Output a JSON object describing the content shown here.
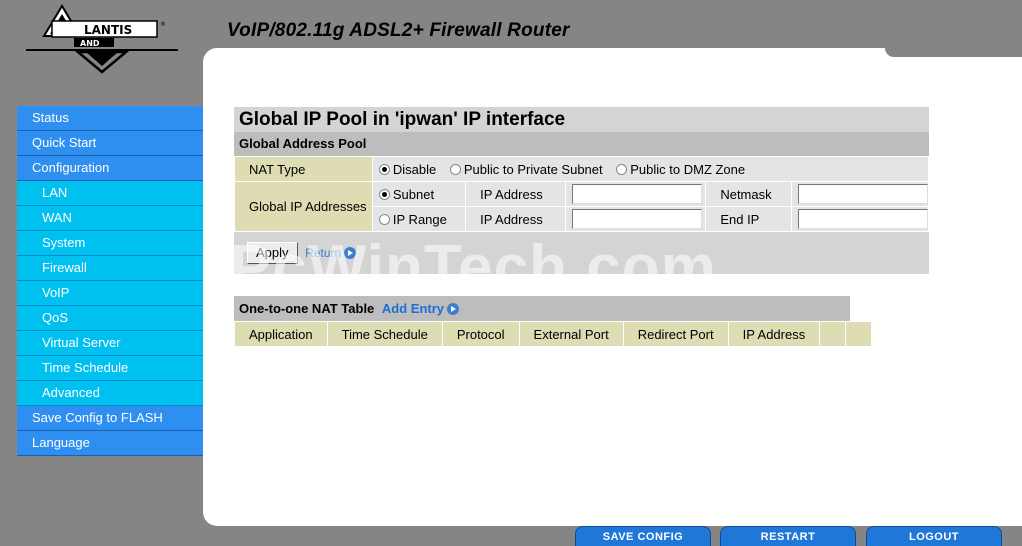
{
  "header": {
    "brand": "ATLANTIS LAND",
    "product_title": "VoIP/802.11g ADSL2+ Firewall Router"
  },
  "sidebar": {
    "items": [
      {
        "label": "Status",
        "level": "main"
      },
      {
        "label": "Quick Start",
        "level": "main"
      },
      {
        "label": "Configuration",
        "level": "main"
      },
      {
        "label": "LAN",
        "level": "sub"
      },
      {
        "label": "WAN",
        "level": "sub"
      },
      {
        "label": "System",
        "level": "sub"
      },
      {
        "label": "Firewall",
        "level": "sub"
      },
      {
        "label": "VoIP",
        "level": "sub"
      },
      {
        "label": "QoS",
        "level": "sub"
      },
      {
        "label": "Virtual Server",
        "level": "sub"
      },
      {
        "label": "Time Schedule",
        "level": "sub"
      },
      {
        "label": "Advanced",
        "level": "sub"
      },
      {
        "label": "Save Config to FLASH",
        "level": "main"
      },
      {
        "label": "Language",
        "level": "main"
      }
    ]
  },
  "page": {
    "title": "Global IP Pool in 'ipwan' IP interface",
    "section_title": "Global Address Pool",
    "nat_type": {
      "label": "NAT Type",
      "options": [
        "Disable",
        "Public to Private Subnet",
        "Public to DMZ Zone"
      ],
      "selected": "Disable"
    },
    "global_ip": {
      "label": "Global IP Addresses",
      "subnet_label": "Subnet",
      "range_label": "IP Range",
      "selected": "Subnet",
      "ip_address_label": "IP Address",
      "netmask_label": "Netmask",
      "end_ip_label": "End IP",
      "subnet_ip_value": "",
      "netmask_value": "",
      "range_ip_value": "",
      "end_ip_value": ""
    },
    "apply_label": "Apply",
    "return_label": "Return"
  },
  "nat_table": {
    "title": "One-to-one NAT Table",
    "add_entry_label": "Add Entry",
    "columns": [
      "Application",
      "Time Schedule",
      "Protocol",
      "External Port",
      "Redirect Port",
      "IP Address",
      "",
      ""
    ]
  },
  "watermark": "PcWinTech.com",
  "footer": {
    "save_label": "SAVE CONFIG",
    "restart_label": "RESTART",
    "logout_label": "LOGOUT"
  },
  "colors": {
    "nav_main": "#2e8ff0",
    "nav_sub": "#00c0f0",
    "label_cell": "#dddcb2",
    "footer_button": "#1f78d8"
  }
}
